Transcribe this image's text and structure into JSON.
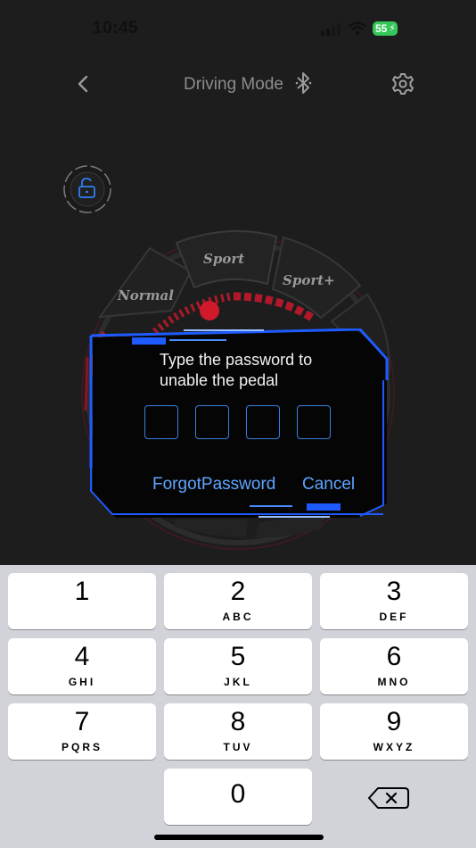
{
  "status_bar": {
    "time": "10:45",
    "battery": "55",
    "icons": [
      "signal-icon",
      "wifi-icon",
      "battery-icon"
    ]
  },
  "nav": {
    "title": "Driving Mode",
    "icons": [
      "back-icon",
      "bluetooth-icon",
      "gear-icon"
    ]
  },
  "lock_icon": "padlock-unlocked-icon",
  "modes": {
    "normal": "Normal",
    "sport": "Sport",
    "sport_plus": "Sport+"
  },
  "modal": {
    "message": "Type the password to unable the pedal",
    "pin_slots": 4,
    "forgot_label": "ForgotPassword",
    "cancel_label": "Cancel"
  },
  "keyboard": {
    "keys": [
      {
        "digit": "1",
        "letters": ""
      },
      {
        "digit": "2",
        "letters": "ABC"
      },
      {
        "digit": "3",
        "letters": "DEF"
      },
      {
        "digit": "4",
        "letters": "GHI"
      },
      {
        "digit": "5",
        "letters": "JKL"
      },
      {
        "digit": "6",
        "letters": "MNO"
      },
      {
        "digit": "7",
        "letters": "PQRS"
      },
      {
        "digit": "8",
        "letters": "TUV"
      },
      {
        "digit": "9",
        "letters": "WXYZ"
      },
      {
        "digit": "0",
        "letters": ""
      }
    ],
    "delete_icon": "backspace-icon"
  },
  "colors": {
    "background": "#1d1d1d",
    "accent_blue": "#1e5bff",
    "link_blue": "#5fa5ff",
    "dial_red": "#c21a2c",
    "keyboard_bg": "#d2d3d9"
  }
}
